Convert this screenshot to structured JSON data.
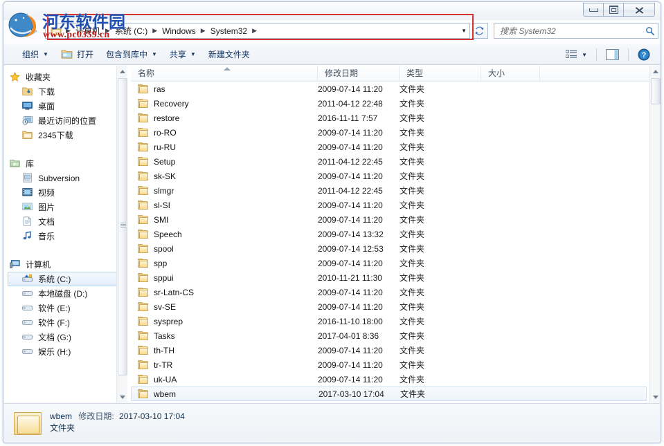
{
  "window": {
    "controls": {
      "minimize": "minimize-button",
      "maximize": "maximize-button",
      "close": "close-button"
    }
  },
  "watermark": {
    "text": "河东软件园",
    "url": "www.pc0359.cn"
  },
  "address_bar": {
    "breadcrumbs": [
      "计算机",
      "系统 (C:)",
      "Windows",
      "System32"
    ],
    "separator": "▶",
    "dropdown_caret": "▼",
    "refresh_title": "刷新"
  },
  "search": {
    "placeholder": "搜索 System32",
    "icon": "search-icon"
  },
  "toolbar": {
    "organize": "组织",
    "open": "打开",
    "include_in_library": "包含到库中",
    "share": "共享",
    "new_folder": "新建文件夹",
    "caret": "▼",
    "view_icon": "view-list-icon",
    "preview_icon": "preview-pane-icon",
    "help_icon": "help-icon"
  },
  "sidebar": {
    "groups": [
      {
        "root": {
          "label": "收藏夹",
          "icon": "star-icon"
        },
        "items": [
          {
            "label": "下载",
            "icon": "downloads-icon"
          },
          {
            "label": "桌面",
            "icon": "desktop-icon"
          },
          {
            "label": "最近访问的位置",
            "icon": "recent-places-icon"
          },
          {
            "label": "2345下载",
            "icon": "folder-icon"
          }
        ]
      },
      {
        "root": {
          "label": "库",
          "icon": "library-icon"
        },
        "items": [
          {
            "label": "Subversion",
            "icon": "subversion-icon"
          },
          {
            "label": "视频",
            "icon": "video-icon"
          },
          {
            "label": "图片",
            "icon": "pictures-icon"
          },
          {
            "label": "文档",
            "icon": "documents-icon"
          },
          {
            "label": "音乐",
            "icon": "music-icon"
          }
        ]
      },
      {
        "root": {
          "label": "计算机",
          "icon": "computer-icon"
        },
        "items": [
          {
            "label": "系统 (C:)",
            "icon": "system-drive-icon",
            "selected": true
          },
          {
            "label": "本地磁盘 (D:)",
            "icon": "drive-icon"
          },
          {
            "label": "软件 (E:)",
            "icon": "drive-icon"
          },
          {
            "label": "软件 (F:)",
            "icon": "drive-icon"
          },
          {
            "label": "文档 (G:)",
            "icon": "drive-icon"
          },
          {
            "label": "娱乐 (H:)",
            "icon": "drive-icon"
          }
        ]
      }
    ]
  },
  "file_list": {
    "columns": [
      "名称",
      "修改日期",
      "类型",
      "大小"
    ],
    "sort_column": "名称",
    "sort_direction": "asc",
    "rows": [
      {
        "name": "ras",
        "date": "2009-07-14 11:20",
        "type": "文件夹",
        "size": ""
      },
      {
        "name": "Recovery",
        "date": "2011-04-12 22:48",
        "type": "文件夹",
        "size": ""
      },
      {
        "name": "restore",
        "date": "2016-11-11 7:57",
        "type": "文件夹",
        "size": ""
      },
      {
        "name": "ro-RO",
        "date": "2009-07-14 11:20",
        "type": "文件夹",
        "size": ""
      },
      {
        "name": "ru-RU",
        "date": "2009-07-14 11:20",
        "type": "文件夹",
        "size": ""
      },
      {
        "name": "Setup",
        "date": "2011-04-12 22:45",
        "type": "文件夹",
        "size": ""
      },
      {
        "name": "sk-SK",
        "date": "2009-07-14 11:20",
        "type": "文件夹",
        "size": ""
      },
      {
        "name": "slmgr",
        "date": "2011-04-12 22:45",
        "type": "文件夹",
        "size": ""
      },
      {
        "name": "sl-SI",
        "date": "2009-07-14 11:20",
        "type": "文件夹",
        "size": ""
      },
      {
        "name": "SMI",
        "date": "2009-07-14 11:20",
        "type": "文件夹",
        "size": ""
      },
      {
        "name": "Speech",
        "date": "2009-07-14 13:32",
        "type": "文件夹",
        "size": ""
      },
      {
        "name": "spool",
        "date": "2009-07-14 12:53",
        "type": "文件夹",
        "size": ""
      },
      {
        "name": "spp",
        "date": "2009-07-14 11:20",
        "type": "文件夹",
        "size": ""
      },
      {
        "name": "sppui",
        "date": "2010-11-21 11:30",
        "type": "文件夹",
        "size": ""
      },
      {
        "name": "sr-Latn-CS",
        "date": "2009-07-14 11:20",
        "type": "文件夹",
        "size": ""
      },
      {
        "name": "sv-SE",
        "date": "2009-07-14 11:20",
        "type": "文件夹",
        "size": ""
      },
      {
        "name": "sysprep",
        "date": "2016-11-10 18:00",
        "type": "文件夹",
        "size": ""
      },
      {
        "name": "Tasks",
        "date": "2017-04-01 8:36",
        "type": "文件夹",
        "size": ""
      },
      {
        "name": "th-TH",
        "date": "2009-07-14 11:20",
        "type": "文件夹",
        "size": ""
      },
      {
        "name": "tr-TR",
        "date": "2009-07-14 11:20",
        "type": "文件夹",
        "size": ""
      },
      {
        "name": "uk-UA",
        "date": "2009-07-14 11:20",
        "type": "文件夹",
        "size": ""
      },
      {
        "name": "wbem",
        "date": "2017-03-10 17:04",
        "type": "文件夹",
        "size": "",
        "selected": true
      }
    ]
  },
  "status_bar": {
    "name": "wbem",
    "date_label": "修改日期:",
    "date_value": "2017-03-10 17:04",
    "type": "文件夹"
  },
  "colors": {
    "annotation_red": "#d6322f",
    "watermark_blue": "#1f4fb0",
    "watermark_red": "#bb1f1f",
    "selection_blue": "#cfe0f2",
    "toolbar_text": "#0b2d5e"
  }
}
